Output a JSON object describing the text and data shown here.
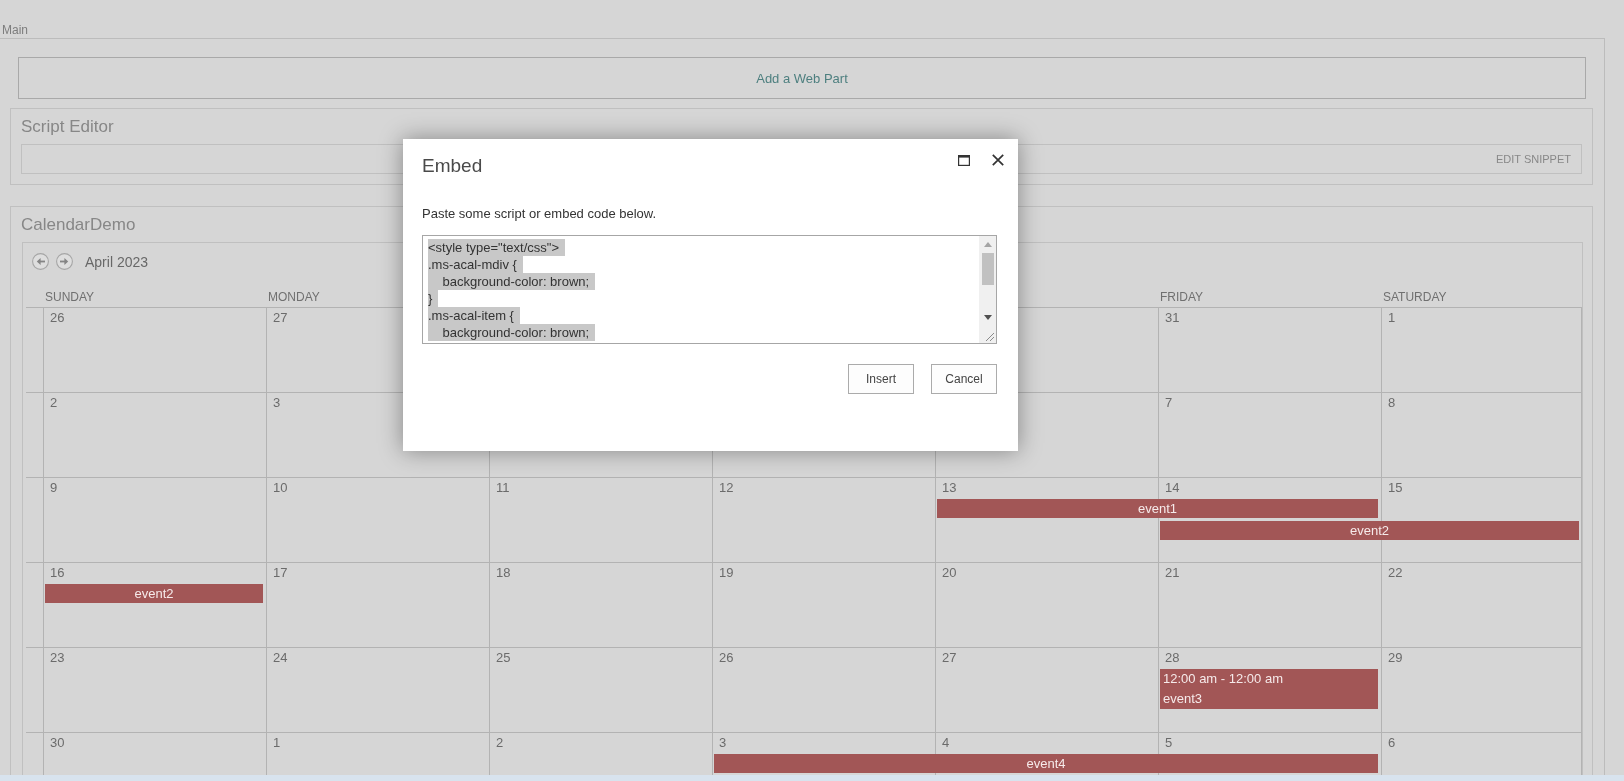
{
  "zone": {
    "label": "Main",
    "add_web_part": "Add a Web Part"
  },
  "script_editor": {
    "title": "Script Editor",
    "edit_link": "EDIT SNIPPET"
  },
  "calendar": {
    "title": "CalendarDemo",
    "month": "April 2023",
    "weekdays": [
      "SUNDAY",
      "MONDAY"
    ],
    "trailing_weekdays": [
      "FRIDAY",
      "SATURDAY"
    ],
    "weeks": [
      {
        "days": [
          "26",
          "27"
        ],
        "trailing_days": [
          "31",
          "1"
        ]
      },
      {
        "days": [
          "2",
          "3"
        ],
        "trailing_days": [
          "7",
          "8"
        ]
      },
      {
        "days": [
          "9",
          "10",
          "11",
          "12",
          "13",
          "14",
          "15"
        ],
        "lanes": [
          [
            {
              "kind": "free"
            },
            {
              "kind": "free"
            },
            {
              "kind": "free"
            },
            {
              "kind": "free"
            },
            {
              "kind": "bar",
              "title": "event1"
            },
            {
              "kind": "continued"
            }
          ],
          [
            {
              "kind": "free"
            },
            {
              "kind": "free"
            },
            {
              "kind": "free"
            },
            {
              "kind": "free"
            },
            {
              "kind": "free"
            },
            {
              "kind": "bar",
              "title": "event2"
            },
            {
              "kind": "continued"
            }
          ]
        ]
      },
      {
        "days": [
          "16",
          "17",
          "18",
          "19",
          "20",
          "21",
          "22"
        ],
        "lanes": [
          [
            {
              "kind": "bar",
              "title": "event2"
            }
          ]
        ]
      },
      {
        "days": [
          "23",
          "24",
          "25",
          "26",
          "27",
          "28",
          "29"
        ],
        "lanes": [
          [
            {
              "kind": "free"
            },
            {
              "kind": "free"
            },
            {
              "kind": "free"
            },
            {
              "kind": "free"
            },
            {
              "kind": "free"
            },
            {
              "kind": "timed",
              "time": "12:00 am - 12:00 am",
              "title": "event3"
            }
          ]
        ]
      },
      {
        "days": [
          "30",
          "1",
          "2",
          "3",
          "4",
          "5",
          "6"
        ],
        "lanes": [
          [
            {
              "kind": "free"
            },
            {
              "kind": "free"
            },
            {
              "kind": "free"
            },
            {
              "kind": "bar",
              "title": "event4"
            },
            {
              "kind": "continued"
            },
            {
              "kind": "continued"
            }
          ]
        ]
      }
    ]
  },
  "dialog": {
    "title": "Embed",
    "instructions": "Paste some script or embed code below.",
    "code_box": {
      "value": "<style type=\"text/css\">\n.ms-acal-mdiv {\n    background-color: brown;\n}\n.ms-acal-item {\n    background-color: brown;",
      "text_selected": true
    },
    "buttons": [
      "Insert",
      "Cancel"
    ]
  }
}
